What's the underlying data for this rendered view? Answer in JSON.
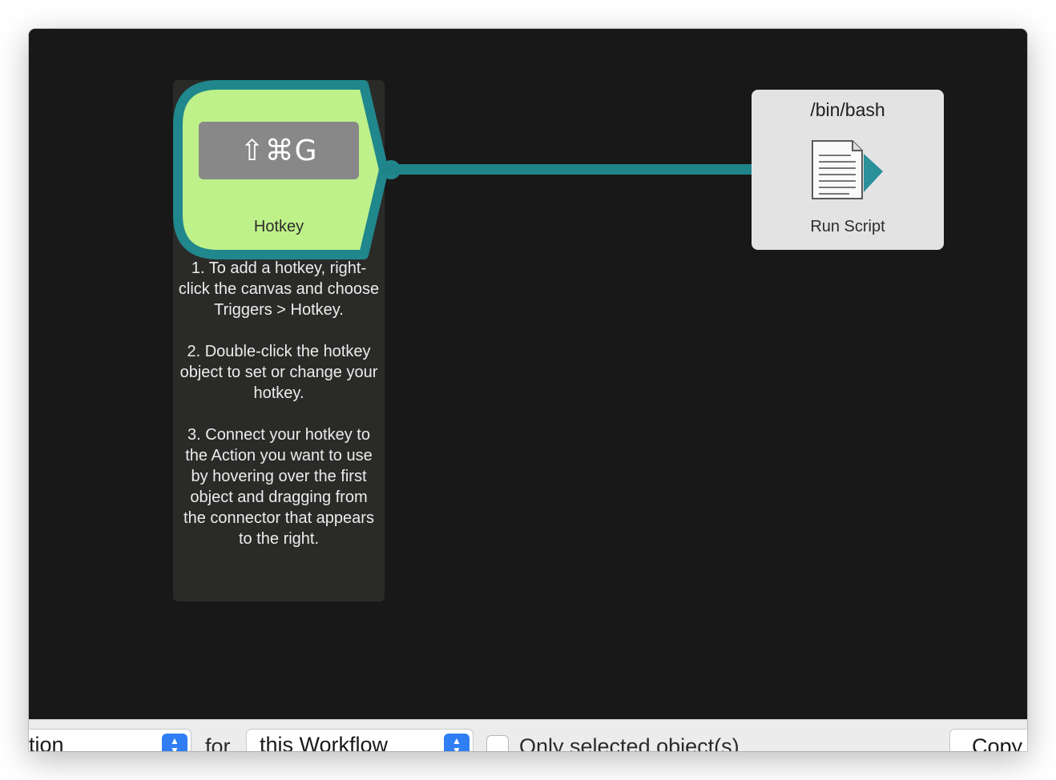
{
  "canvas": {
    "hotkey_object": {
      "shortcut": "⇧⌘G",
      "label": "Hotkey",
      "instructions": [
        "1. To add a hotkey, right-click the canvas and choose Triggers > Hotkey.",
        "2. Double-click the hotkey object to set or change your hotkey.",
        "3. Connect your hotkey to the Action you want to use by hovering over the first object and dragging from the connector that appears to the right."
      ]
    },
    "action_object": {
      "title": "/bin/bash",
      "label": "Run Script",
      "icon": "script-document-icon"
    }
  },
  "toolbar": {
    "scope_popup_value": "tion",
    "for_label": "for",
    "workflow_popup_value": "this Workflow",
    "only_selected_label": "Only selected object(s)",
    "only_selected_checked": false,
    "copy_label": "Copy"
  },
  "colors": {
    "canvas_bg": "#181818",
    "hotkey_fill": "#bff18a",
    "hotkey_border": "#20878c",
    "connector": "#1f8489",
    "action_bg": "#e3e3e3",
    "note_bg": "#2a2b28",
    "stepper_blue": "#2f7ef3"
  }
}
